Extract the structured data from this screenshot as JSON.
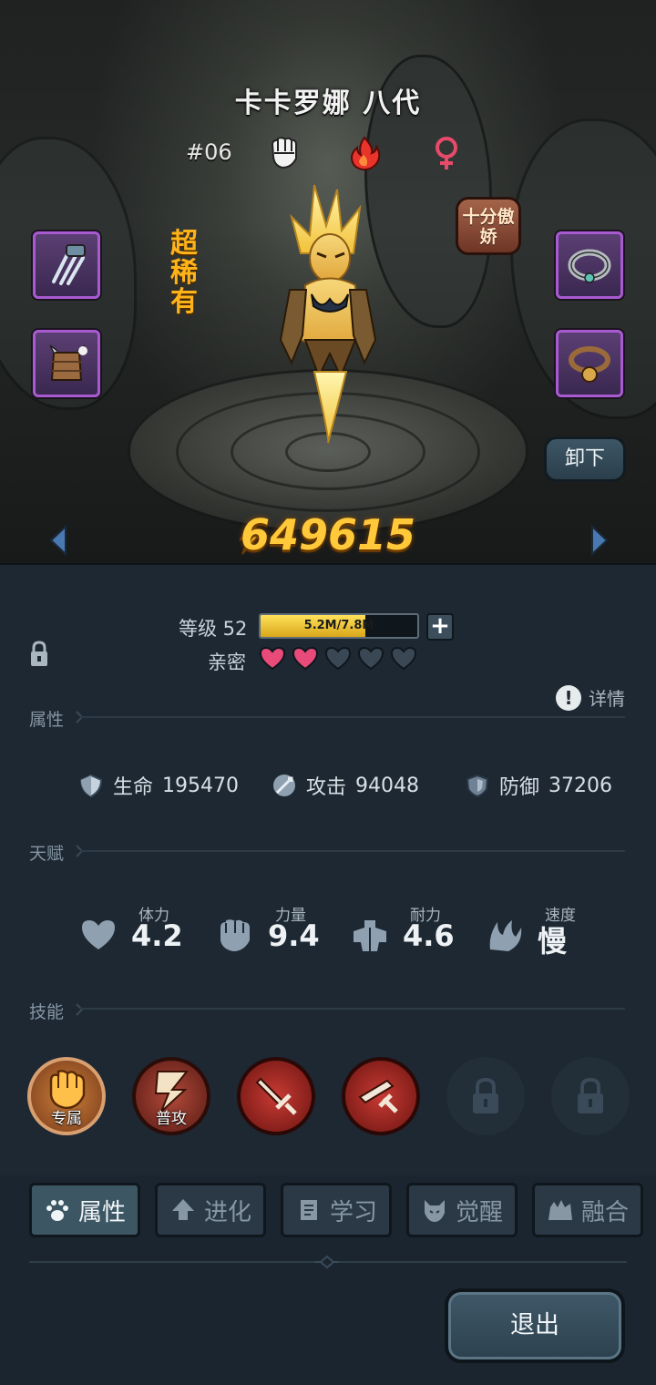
{
  "character": {
    "name": "卡卡罗娜 八代",
    "number": "#06",
    "rarity": "超稀有",
    "trait": "十分傲娇",
    "type_icons": [
      "fist-icon",
      "fire-icon",
      "female-icon"
    ],
    "power": "649615"
  },
  "equipment": {
    "left": [
      "claw-weapon-icon",
      "spiked-barrel-armor-icon"
    ],
    "right": [
      "stone-collar-icon",
      "bell-collar-icon"
    ],
    "unequip_label": "卸下"
  },
  "level": {
    "label": "等级 52",
    "xp_text": "5.2M/7.8M",
    "xp_fraction": 0.667,
    "plus": "+"
  },
  "affinity": {
    "label": "亲密",
    "filled": 2,
    "total": 5
  },
  "details_label": "详情",
  "sections": {
    "attributes": "属性",
    "talents": "天赋",
    "skills": "技能"
  },
  "stats": [
    {
      "name": "生命",
      "value": "195470",
      "icon": "health-icon"
    },
    {
      "name": "攻击",
      "value": "94048",
      "icon": "attack-icon"
    },
    {
      "name": "防御",
      "value": "37206",
      "icon": "defense-icon"
    }
  ],
  "talents": [
    {
      "name": "体力",
      "value": "4.2",
      "icon": "heart-icon"
    },
    {
      "name": "力量",
      "value": "9.4",
      "icon": "fist-icon"
    },
    {
      "name": "耐力",
      "value": "4.6",
      "icon": "muscle-icon"
    },
    {
      "name": "速度",
      "value": "慢",
      "icon": "wing-icon"
    }
  ],
  "skills": [
    {
      "label": "专属",
      "icon": "punch-skill-icon"
    },
    {
      "label": "普攻",
      "icon": "lightning-skill-icon"
    },
    {
      "label": "",
      "icon": "sword-skill-icon"
    },
    {
      "label": "",
      "icon": "sword-slash-skill-icon"
    },
    {
      "label": "",
      "icon": "lock-icon"
    },
    {
      "label": "",
      "icon": "lock-icon"
    }
  ],
  "tabs": [
    {
      "label": "属性",
      "icon": "paw-icon",
      "active": true
    },
    {
      "label": "进化",
      "icon": "arrow-up-icon",
      "active": false
    },
    {
      "label": "学习",
      "icon": "book-icon",
      "active": false
    },
    {
      "label": "觉醒",
      "icon": "demon-head-icon",
      "active": false
    },
    {
      "label": "融合",
      "icon": "fusion-icon",
      "active": false
    }
  ],
  "exit_label": "退出",
  "colors": {
    "panel": "#1d2833",
    "power": "#ffc93a",
    "rarity": "#ffb31a",
    "heart_filled": "#e84a7a",
    "heart_empty": "#3a4855",
    "slot_border": "#a85ad0"
  }
}
